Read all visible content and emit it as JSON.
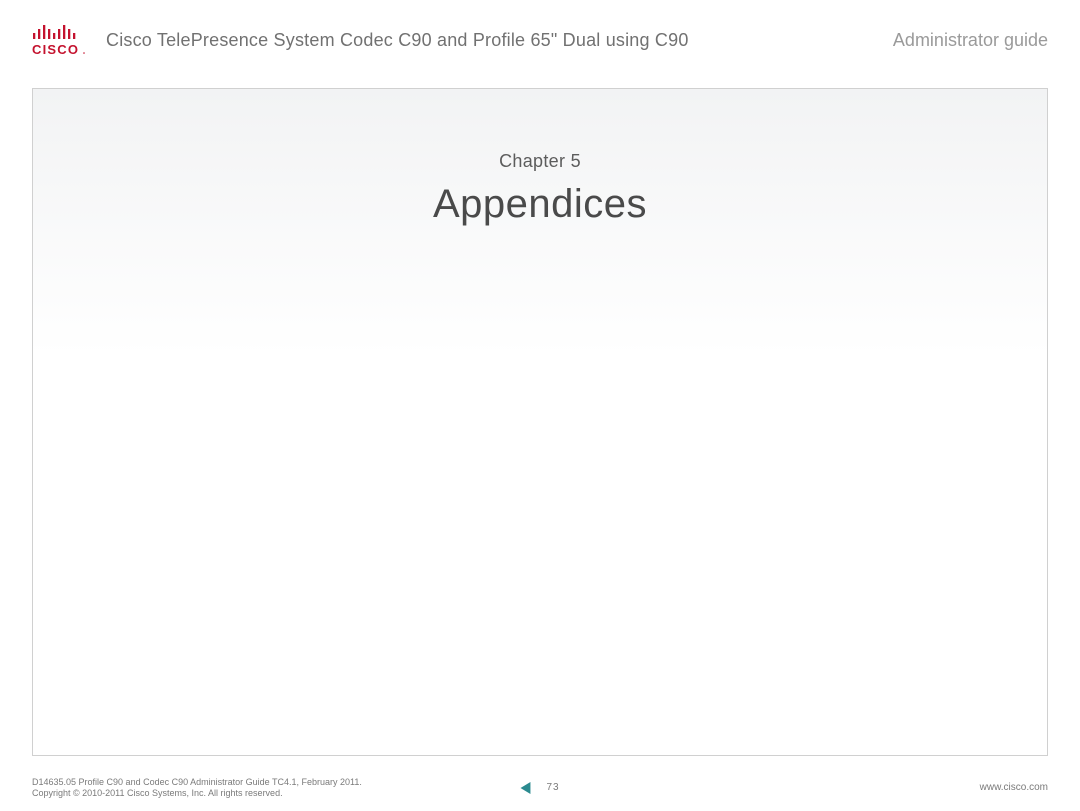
{
  "header": {
    "doc_title": "Cisco TelePresence System Codec C90 and Profile 65\" Dual using C90",
    "guide_label": "Administrator guide"
  },
  "content": {
    "chapter_label": "Chapter 5",
    "chapter_title": "Appendices"
  },
  "footer": {
    "line1": "D14635.05 Profile C90 and Codec C90 Administrator Guide TC4.1, February 2011.",
    "line2": "Copyright © 2010-2011 Cisco Systems, Inc. All rights reserved.",
    "page_number": "73",
    "url": "www.cisco.com"
  },
  "colors": {
    "cisco_red": "#c4122e",
    "arrow_teal": "#2b8a8f"
  }
}
